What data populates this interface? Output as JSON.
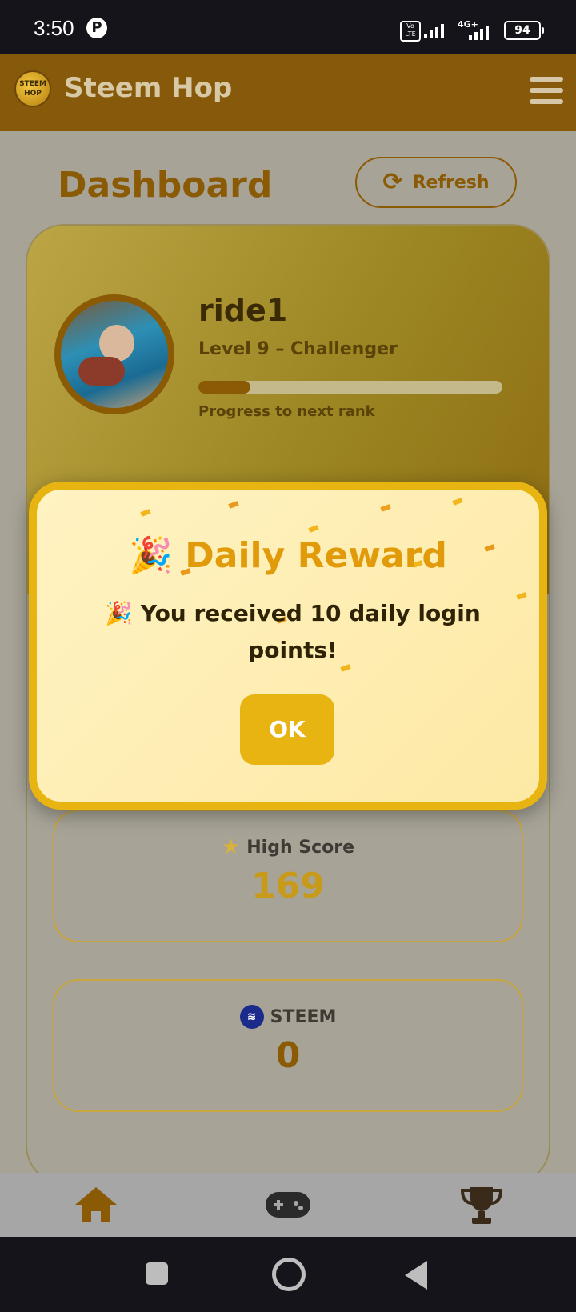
{
  "status_bar": {
    "time": "3:50",
    "battery": "94",
    "network": "4G+",
    "volte": "Vo LTE"
  },
  "app_bar": {
    "title": "Steem Hop",
    "logo_text": "STEEM HOP"
  },
  "dashboard": {
    "title": "Dashboard",
    "refresh_label": "Refresh"
  },
  "profile": {
    "username": "ride1",
    "level": "Level 9 – Challenger",
    "progress_fraction": 0.17,
    "progress_label": "Progress to next rank"
  },
  "stats": {
    "high_score_label": "High Score",
    "high_score_value": "169",
    "steem_label": "STEEM",
    "steem_value": "0"
  },
  "modal": {
    "title": "Daily Reward",
    "message": "You received 10 daily login points!",
    "ok_label": "OK",
    "emoji": "🎉"
  },
  "colors": {
    "app_bar": "#87590a",
    "accent": "#e8b412",
    "brand_brown": "#8a5a05",
    "high_score_value": "#c89a1a",
    "steem_value": "#8a5a05"
  }
}
